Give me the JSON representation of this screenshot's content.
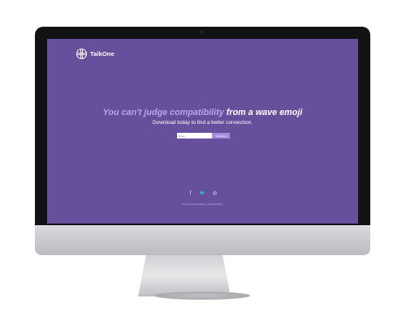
{
  "brand": {
    "name": "TalkOne",
    "logo_icon": "globe-grid-icon"
  },
  "hero": {
    "headline_accent": "You can't judge compatibility",
    "headline_rest": " from a wave emoji",
    "subline": "Download today to find a better connection."
  },
  "form": {
    "email_placeholder": "Email",
    "subscribe_label": "Subscribe"
  },
  "social": [
    {
      "name": "facebook-icon",
      "glyph": "f"
    },
    {
      "name": "twitter-icon",
      "glyph": "🐦"
    },
    {
      "name": "instagram-icon",
      "glyph": "◎"
    }
  ],
  "footer": {
    "links": "Terms and Conditions | Privacy Policy"
  },
  "colors": {
    "background": "#664f9b",
    "accent": "#b9a6e8",
    "button": "#a48bdd"
  }
}
